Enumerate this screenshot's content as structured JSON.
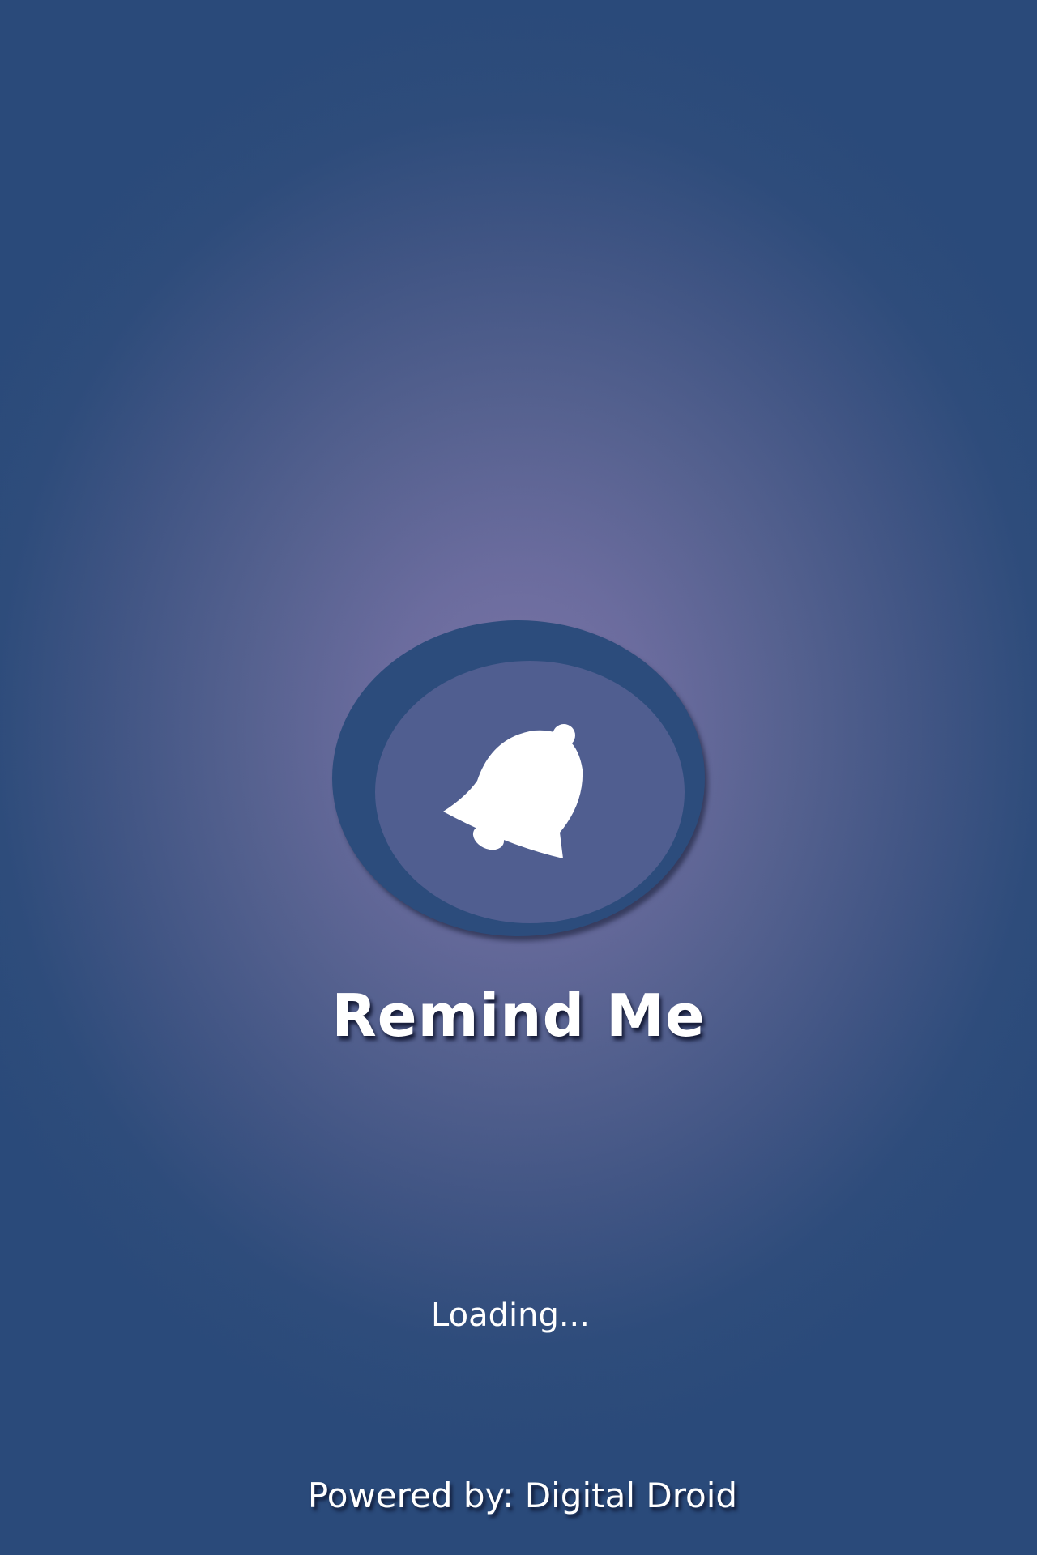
{
  "app": {
    "title": "Remind Me"
  },
  "status": {
    "loading_text": "Loading..."
  },
  "footer": {
    "powered_by": "Powered by: Digital Droid"
  },
  "icons": {
    "logo": "bell-icon"
  },
  "colors": {
    "background_center": "#7a75a6",
    "background_edge": "#2a4a7a",
    "logo_outer": "#2c4c7c",
    "logo_inner": "#505e90",
    "text": "#ffffff"
  }
}
